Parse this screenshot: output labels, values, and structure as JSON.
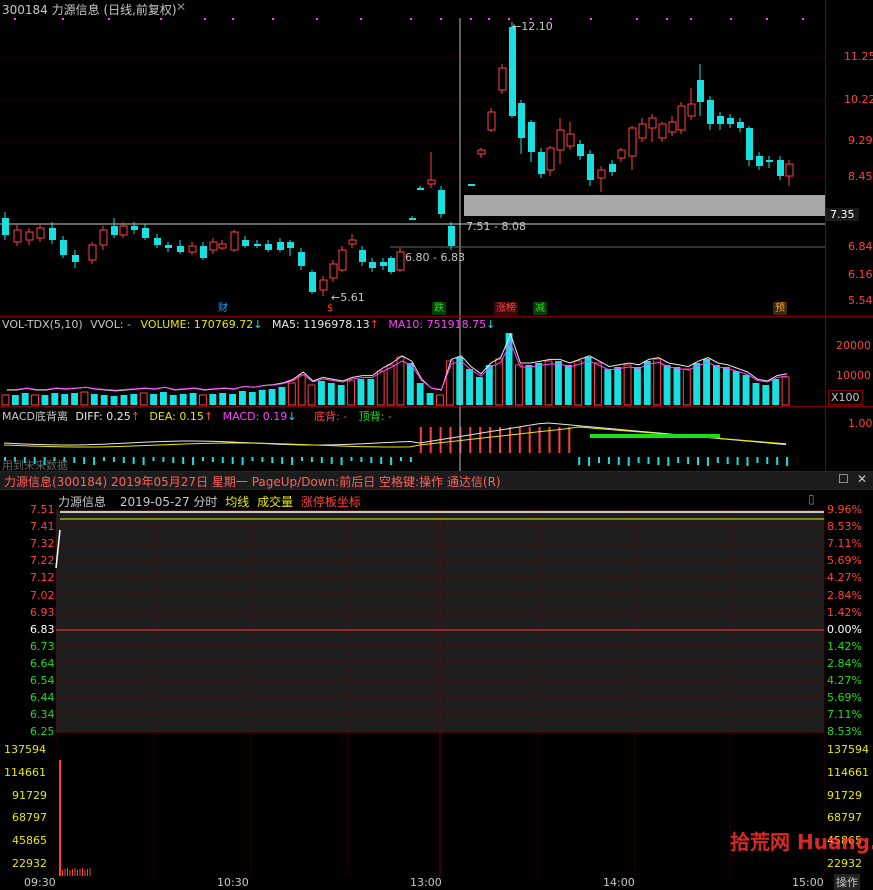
{
  "top_chart": {
    "title": "300184 力源信息 (日线,前复权)",
    "price_axis": [
      "11.25",
      "10.22",
      "9.29",
      "8.45",
      "7.35",
      "6.84",
      "6.16",
      "5.54"
    ],
    "current_price": "7.35",
    "annotations": {
      "high": "12.10",
      "low": "5.61",
      "range1": "7.51 - 8.08",
      "range2": "6.80 - 6.83"
    },
    "event_tags": [
      {
        "label": "财",
        "color": "#18a0ff"
      },
      {
        "label": "$",
        "color": "#ff4040"
      },
      {
        "label": "跌",
        "color": "#18e018"
      },
      {
        "label": "涨榜",
        "color": "#ff4040"
      },
      {
        "label": "减",
        "color": "#18e018"
      },
      {
        "label": "预",
        "color": "#ffa040"
      }
    ]
  },
  "volume_panel": {
    "title": "VOL-TDX(5,10)",
    "vvol": "VVOL: -",
    "volume": "VOLUME: 170769.72",
    "ma5": "MA5: 1196978.13",
    "ma10": "MA10: 751918.75",
    "axis": [
      "20000",
      "10000"
    ],
    "multiplier": "X100"
  },
  "macd_panel": {
    "title": "MACD底背离",
    "diff": "DIFF: 0.25",
    "dea": "DEA: 0.15",
    "macd": "MACD: 0.19",
    "bottom_div": "底背: -",
    "top_div": "顶背: -",
    "axis": [
      "1.00"
    ],
    "status": "用到未来数据"
  },
  "intraday_window": {
    "title": "力源信息(300184) 2019年05月27日 星期一 PageUp/Down:前后日 空格键:操作 通达信(R)",
    "subtitle_name": "力源信息",
    "subtitle_time": "2019-05-27 分时",
    "legend_avg": "均线",
    "legend_vol": "成交量",
    "legend_limit": "涨停板坐标",
    "price_left": [
      "7.51",
      "7.41",
      "7.32",
      "7.22",
      "7.12",
      "7.02",
      "6.93",
      "6.83",
      "6.73",
      "6.64",
      "6.54",
      "6.44",
      "6.34",
      "6.25"
    ],
    "pct_right": [
      "9.96%",
      "8.53%",
      "7.11%",
      "5.69%",
      "4.27%",
      "2.84%",
      "1.42%",
      "0.00%",
      "1.42%",
      "2.84%",
      "4.27%",
      "5.69%",
      "7.11%",
      "8.53%"
    ],
    "vol_axis": [
      "137594",
      "114661",
      "91729",
      "68797",
      "45865",
      "22932"
    ],
    "time_axis": [
      "09:30",
      "10:30",
      "13:00",
      "14:00",
      "15:00"
    ],
    "corner_label": "操作",
    "watermark": "拾荒网 Huang.CN"
  },
  "colors": {
    "up": "#ff4040",
    "down": "#18e0e0",
    "grid": "#800000",
    "avg_line": "#e8e800"
  }
}
